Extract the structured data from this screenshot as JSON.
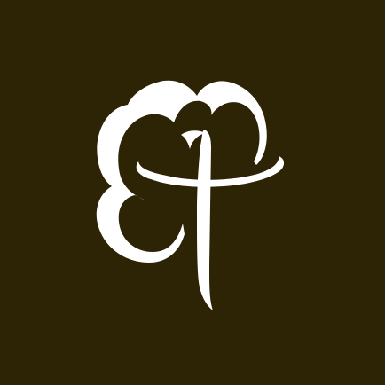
{
  "colors": {
    "background": "#2d2405",
    "mark": "#ffffff"
  },
  "logo": {
    "icon": "cloud-monogram-icon"
  }
}
